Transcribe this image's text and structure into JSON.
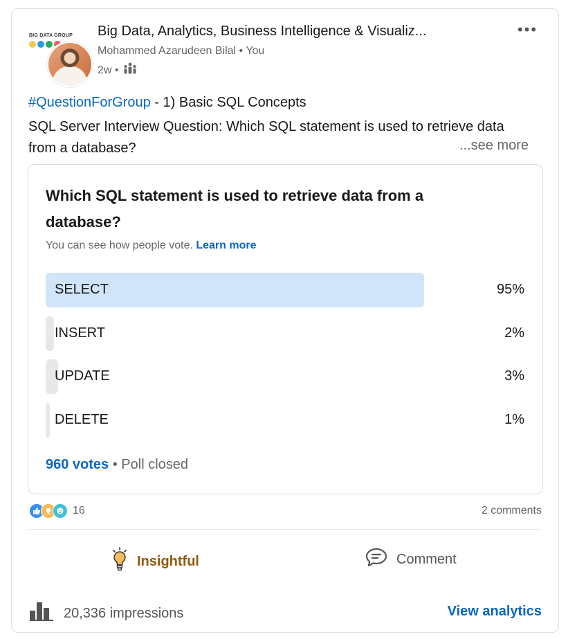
{
  "post": {
    "group_name": "Big Data, Analytics, Business Intelligence & Visualiz...",
    "group_logo_text": "BIG DATA GROUP",
    "author": "Mohammed Azarudeen Bilal • You",
    "time": "2w •",
    "visibility_icon": "group-icon",
    "more_label": "•••",
    "hashtag": "#QuestionForGroup",
    "title_rest": " - 1) Basic SQL Concepts",
    "body": "SQL Server Interview Question: Which SQL statement is used to retrieve data from a database?",
    "see_more": "...see more"
  },
  "poll": {
    "question": "Which SQL statement is used to retrieve data from a database?",
    "note": "You can see how people vote.",
    "learn_more": "Learn more",
    "options": [
      {
        "label": "SELECT",
        "percent_text": "95%",
        "percent": 95
      },
      {
        "label": "INSERT",
        "percent_text": "2%",
        "percent": 2
      },
      {
        "label": "UPDATE",
        "percent_text": "3%",
        "percent": 3
      },
      {
        "label": "DELETE",
        "percent_text": "1%",
        "percent": 1
      }
    ],
    "votes": "960 votes",
    "status": " • Poll closed"
  },
  "social": {
    "reaction_icons": [
      "like-icon",
      "insightful-icon",
      "funny-icon"
    ],
    "reaction_count": "16",
    "comments": "2 comments"
  },
  "actions": {
    "insightful_label": "Insightful",
    "comment_label": "Comment"
  },
  "footer": {
    "impressions": "20,336 impressions",
    "view_analytics": "View analytics"
  },
  "colors": {
    "link": "#0a66c2",
    "winner_fill": "#d0e4fa",
    "option_fill": "#e8e8e8",
    "insightful": "#915907"
  }
}
